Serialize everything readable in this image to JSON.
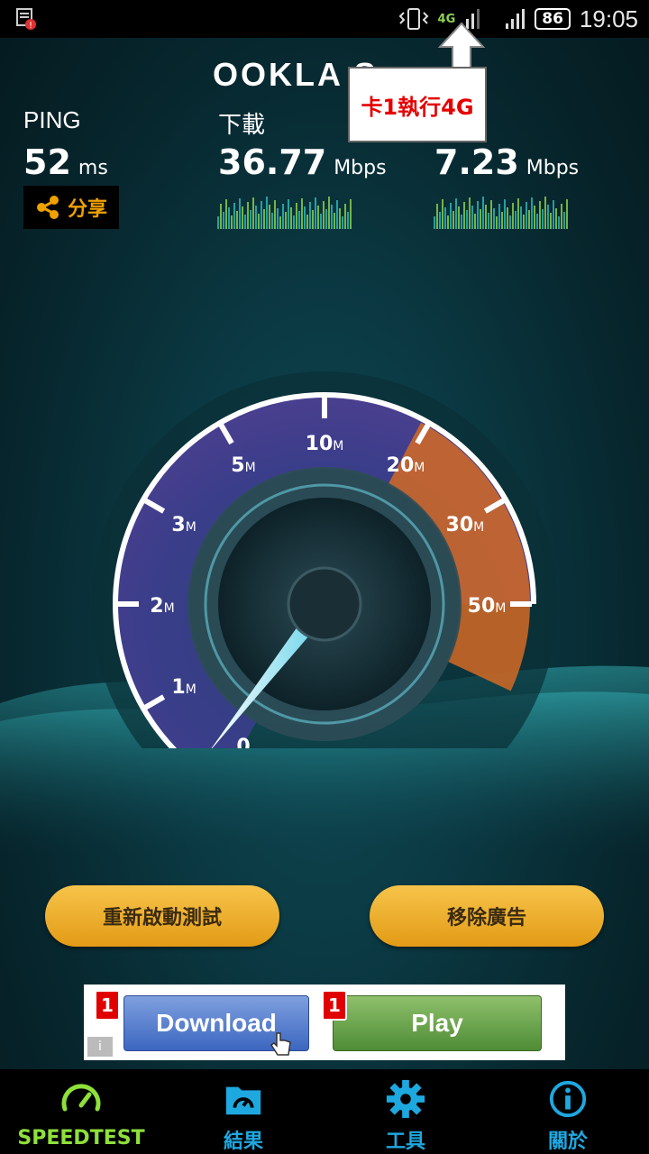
{
  "status_bar": {
    "network_type": "4G",
    "battery": "86",
    "time": "19:05"
  },
  "callout": {
    "text": "卡1執行4G"
  },
  "header": {
    "logo": "OOKLA S"
  },
  "stats": {
    "ping": {
      "label": "PING",
      "value": "52",
      "unit": "ms"
    },
    "download": {
      "label": "下載",
      "value": "36.77",
      "unit": "Mbps"
    },
    "upload": {
      "value": "7.23",
      "unit": "Mbps"
    }
  },
  "share": {
    "label": "分享"
  },
  "gauge": {
    "ticks": [
      {
        "value": "0",
        "unit": ""
      },
      {
        "value": "1",
        "unit": "M"
      },
      {
        "value": "2",
        "unit": "M"
      },
      {
        "value": "3",
        "unit": "M"
      },
      {
        "value": "5",
        "unit": "M"
      },
      {
        "value": "10",
        "unit": "M"
      },
      {
        "value": "20",
        "unit": "M"
      },
      {
        "value": "30",
        "unit": "M"
      },
      {
        "value": "50",
        "unit": "M"
      }
    ]
  },
  "actions": {
    "restart_label": "重新啟動測試",
    "remove_ads_label": "移除廣告"
  },
  "ad": {
    "download_label": "Download",
    "play_label": "Play",
    "badge": "1",
    "info": "i"
  },
  "nav": {
    "items": [
      {
        "label": "SPEEDTEST",
        "icon": "speedometer-icon",
        "color": "#8fe03a"
      },
      {
        "label": "結果",
        "icon": "results-icon",
        "color": "#1ea8e0"
      },
      {
        "label": "工具",
        "icon": "gear-icon",
        "color": "#1ea8e0"
      },
      {
        "label": "關於",
        "icon": "info-icon",
        "color": "#1ea8e0"
      }
    ]
  }
}
